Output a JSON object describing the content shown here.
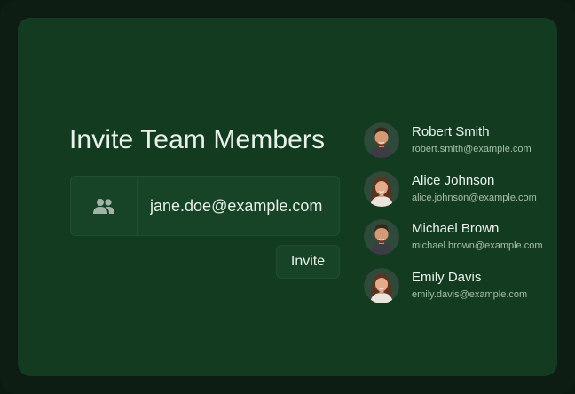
{
  "invite": {
    "title": "Invite Team Members",
    "email_value": "jane.doe@example.com",
    "button_label": "Invite",
    "input_icon": "users-icon"
  },
  "members": [
    {
      "name": "Robert Smith",
      "email": "robert.smith@example.com",
      "avatar": "avatar-male"
    },
    {
      "name": "Alice Johnson",
      "email": "alice.johnson@example.com",
      "avatar": "avatar-female"
    },
    {
      "name": "Michael Brown",
      "email": "michael.brown@example.com",
      "avatar": "avatar-male"
    },
    {
      "name": "Emily Davis",
      "email": "emily.davis@example.com",
      "avatar": "avatar-female"
    }
  ],
  "colors": {
    "background": "#0e1d13",
    "card": "#123b20",
    "field": "#174327",
    "text": "#e9f1eb",
    "muted_text": "#a9bdae"
  }
}
